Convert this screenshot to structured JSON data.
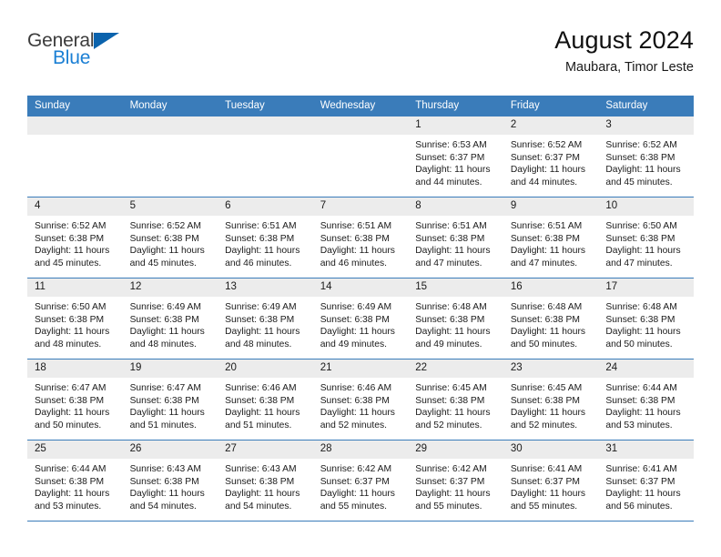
{
  "logo": {
    "word1": "General",
    "word2": "Blue",
    "triangle_color": "#0b63ad",
    "blue_color": "#1a7fd4"
  },
  "header": {
    "title": "August 2024",
    "subtitle": "Maubara, Timor Leste"
  },
  "theme": {
    "header_blue": "#3a7cba",
    "daynum_gray": "#ececec"
  },
  "weekday_headers": [
    "Sunday",
    "Monday",
    "Tuesday",
    "Wednesday",
    "Thursday",
    "Friday",
    "Saturday"
  ],
  "labels": {
    "sunrise": "Sunrise:",
    "sunset": "Sunset:",
    "daylight": "Daylight:"
  },
  "weeks": [
    [
      {
        "day": "",
        "empty": true
      },
      {
        "day": "",
        "empty": true
      },
      {
        "day": "",
        "empty": true
      },
      {
        "day": "",
        "empty": true
      },
      {
        "day": "1",
        "sunrise": "Sunrise: 6:53 AM",
        "sunset": "Sunset: 6:37 PM",
        "daylight1": "Daylight: 11 hours",
        "daylight2": "and 44 minutes."
      },
      {
        "day": "2",
        "sunrise": "Sunrise: 6:52 AM",
        "sunset": "Sunset: 6:37 PM",
        "daylight1": "Daylight: 11 hours",
        "daylight2": "and 44 minutes."
      },
      {
        "day": "3",
        "sunrise": "Sunrise: 6:52 AM",
        "sunset": "Sunset: 6:38 PM",
        "daylight1": "Daylight: 11 hours",
        "daylight2": "and 45 minutes."
      }
    ],
    [
      {
        "day": "4",
        "sunrise": "Sunrise: 6:52 AM",
        "sunset": "Sunset: 6:38 PM",
        "daylight1": "Daylight: 11 hours",
        "daylight2": "and 45 minutes."
      },
      {
        "day": "5",
        "sunrise": "Sunrise: 6:52 AM",
        "sunset": "Sunset: 6:38 PM",
        "daylight1": "Daylight: 11 hours",
        "daylight2": "and 45 minutes."
      },
      {
        "day": "6",
        "sunrise": "Sunrise: 6:51 AM",
        "sunset": "Sunset: 6:38 PM",
        "daylight1": "Daylight: 11 hours",
        "daylight2": "and 46 minutes."
      },
      {
        "day": "7",
        "sunrise": "Sunrise: 6:51 AM",
        "sunset": "Sunset: 6:38 PM",
        "daylight1": "Daylight: 11 hours",
        "daylight2": "and 46 minutes."
      },
      {
        "day": "8",
        "sunrise": "Sunrise: 6:51 AM",
        "sunset": "Sunset: 6:38 PM",
        "daylight1": "Daylight: 11 hours",
        "daylight2": "and 47 minutes."
      },
      {
        "day": "9",
        "sunrise": "Sunrise: 6:51 AM",
        "sunset": "Sunset: 6:38 PM",
        "daylight1": "Daylight: 11 hours",
        "daylight2": "and 47 minutes."
      },
      {
        "day": "10",
        "sunrise": "Sunrise: 6:50 AM",
        "sunset": "Sunset: 6:38 PM",
        "daylight1": "Daylight: 11 hours",
        "daylight2": "and 47 minutes."
      }
    ],
    [
      {
        "day": "11",
        "sunrise": "Sunrise: 6:50 AM",
        "sunset": "Sunset: 6:38 PM",
        "daylight1": "Daylight: 11 hours",
        "daylight2": "and 48 minutes."
      },
      {
        "day": "12",
        "sunrise": "Sunrise: 6:49 AM",
        "sunset": "Sunset: 6:38 PM",
        "daylight1": "Daylight: 11 hours",
        "daylight2": "and 48 minutes."
      },
      {
        "day": "13",
        "sunrise": "Sunrise: 6:49 AM",
        "sunset": "Sunset: 6:38 PM",
        "daylight1": "Daylight: 11 hours",
        "daylight2": "and 48 minutes."
      },
      {
        "day": "14",
        "sunrise": "Sunrise: 6:49 AM",
        "sunset": "Sunset: 6:38 PM",
        "daylight1": "Daylight: 11 hours",
        "daylight2": "and 49 minutes."
      },
      {
        "day": "15",
        "sunrise": "Sunrise: 6:48 AM",
        "sunset": "Sunset: 6:38 PM",
        "daylight1": "Daylight: 11 hours",
        "daylight2": "and 49 minutes."
      },
      {
        "day": "16",
        "sunrise": "Sunrise: 6:48 AM",
        "sunset": "Sunset: 6:38 PM",
        "daylight1": "Daylight: 11 hours",
        "daylight2": "and 50 minutes."
      },
      {
        "day": "17",
        "sunrise": "Sunrise: 6:48 AM",
        "sunset": "Sunset: 6:38 PM",
        "daylight1": "Daylight: 11 hours",
        "daylight2": "and 50 minutes."
      }
    ],
    [
      {
        "day": "18",
        "sunrise": "Sunrise: 6:47 AM",
        "sunset": "Sunset: 6:38 PM",
        "daylight1": "Daylight: 11 hours",
        "daylight2": "and 50 minutes."
      },
      {
        "day": "19",
        "sunrise": "Sunrise: 6:47 AM",
        "sunset": "Sunset: 6:38 PM",
        "daylight1": "Daylight: 11 hours",
        "daylight2": "and 51 minutes."
      },
      {
        "day": "20",
        "sunrise": "Sunrise: 6:46 AM",
        "sunset": "Sunset: 6:38 PM",
        "daylight1": "Daylight: 11 hours",
        "daylight2": "and 51 minutes."
      },
      {
        "day": "21",
        "sunrise": "Sunrise: 6:46 AM",
        "sunset": "Sunset: 6:38 PM",
        "daylight1": "Daylight: 11 hours",
        "daylight2": "and 52 minutes."
      },
      {
        "day": "22",
        "sunrise": "Sunrise: 6:45 AM",
        "sunset": "Sunset: 6:38 PM",
        "daylight1": "Daylight: 11 hours",
        "daylight2": "and 52 minutes."
      },
      {
        "day": "23",
        "sunrise": "Sunrise: 6:45 AM",
        "sunset": "Sunset: 6:38 PM",
        "daylight1": "Daylight: 11 hours",
        "daylight2": "and 52 minutes."
      },
      {
        "day": "24",
        "sunrise": "Sunrise: 6:44 AM",
        "sunset": "Sunset: 6:38 PM",
        "daylight1": "Daylight: 11 hours",
        "daylight2": "and 53 minutes."
      }
    ],
    [
      {
        "day": "25",
        "sunrise": "Sunrise: 6:44 AM",
        "sunset": "Sunset: 6:38 PM",
        "daylight1": "Daylight: 11 hours",
        "daylight2": "and 53 minutes."
      },
      {
        "day": "26",
        "sunrise": "Sunrise: 6:43 AM",
        "sunset": "Sunset: 6:38 PM",
        "daylight1": "Daylight: 11 hours",
        "daylight2": "and 54 minutes."
      },
      {
        "day": "27",
        "sunrise": "Sunrise: 6:43 AM",
        "sunset": "Sunset: 6:38 PM",
        "daylight1": "Daylight: 11 hours",
        "daylight2": "and 54 minutes."
      },
      {
        "day": "28",
        "sunrise": "Sunrise: 6:42 AM",
        "sunset": "Sunset: 6:37 PM",
        "daylight1": "Daylight: 11 hours",
        "daylight2": "and 55 minutes."
      },
      {
        "day": "29",
        "sunrise": "Sunrise: 6:42 AM",
        "sunset": "Sunset: 6:37 PM",
        "daylight1": "Daylight: 11 hours",
        "daylight2": "and 55 minutes."
      },
      {
        "day": "30",
        "sunrise": "Sunrise: 6:41 AM",
        "sunset": "Sunset: 6:37 PM",
        "daylight1": "Daylight: 11 hours",
        "daylight2": "and 55 minutes."
      },
      {
        "day": "31",
        "sunrise": "Sunrise: 6:41 AM",
        "sunset": "Sunset: 6:37 PM",
        "daylight1": "Daylight: 11 hours",
        "daylight2": "and 56 minutes."
      }
    ]
  ]
}
